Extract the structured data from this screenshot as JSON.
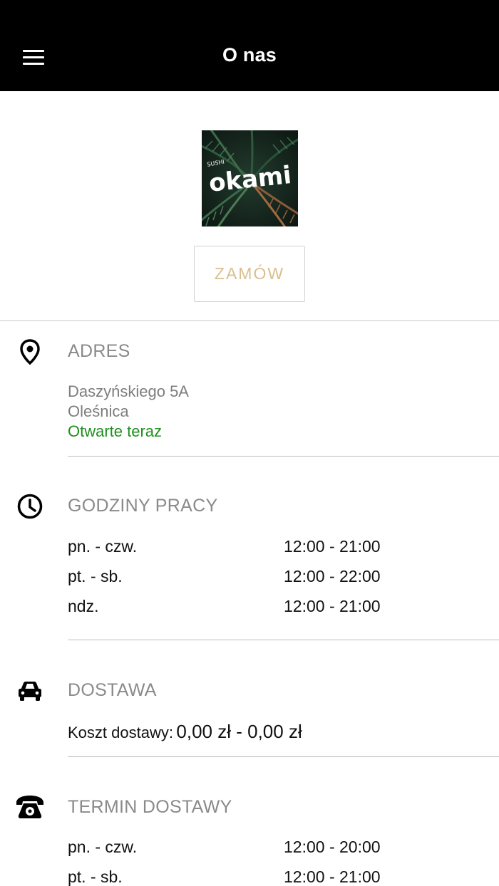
{
  "header": {
    "title": "O nas",
    "menu_icon": "hamburger-menu-icon"
  },
  "logo": {
    "brand_text": "okami",
    "small_text": "SUSHI"
  },
  "order_button": {
    "label": "ZAMÓW"
  },
  "address": {
    "icon": "map-pin-icon",
    "title": "ADRES",
    "street": "Daszyńskiego 5A",
    "city": "Oleśnica",
    "status": "Otwarte teraz",
    "status_color": "#1e8f1e"
  },
  "opening_hours": {
    "icon": "clock-icon",
    "title": "GODZINY PRACY",
    "rows": [
      {
        "day": "pn. - czw.",
        "time": "12:00 - 21:00"
      },
      {
        "day": "pt. - sb.",
        "time": "12:00 - 22:00"
      },
      {
        "day": "ndz.",
        "time": "12:00 - 21:00"
      }
    ]
  },
  "delivery": {
    "icon": "car-icon",
    "title": "DOSTAWA",
    "cost_label": "Koszt dostawy:",
    "cost_value": "0,00 zł - 0,00 zł"
  },
  "delivery_hours": {
    "icon": "telephone-icon",
    "title": "TERMIN DOSTAWY",
    "rows": [
      {
        "day": "pn. - czw.",
        "time": "12:00 - 20:00"
      },
      {
        "day": "pt. - sb.",
        "time": "12:00 - 21:00"
      }
    ]
  },
  "colors": {
    "header_bg": "#000000",
    "accent_gold": "#d9bf8f",
    "section_title": "#8a8a8a"
  }
}
